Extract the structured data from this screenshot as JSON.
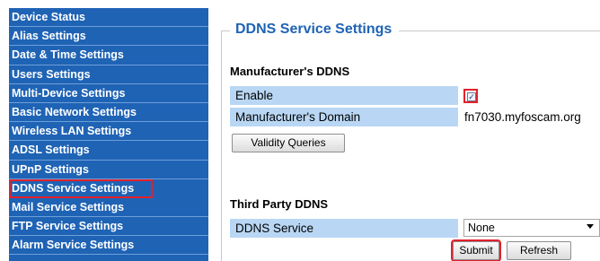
{
  "sidebar": {
    "items": [
      {
        "label": "Device Status"
      },
      {
        "label": "Alias Settings"
      },
      {
        "label": "Date & Time Settings"
      },
      {
        "label": "Users Settings"
      },
      {
        "label": "Multi-Device Settings"
      },
      {
        "label": "Basic Network Settings"
      },
      {
        "label": "Wireless LAN Settings"
      },
      {
        "label": "ADSL Settings"
      },
      {
        "label": "UPnP Settings"
      },
      {
        "label": "DDNS Service Settings"
      },
      {
        "label": "Mail Service Settings"
      },
      {
        "label": "FTP Service Settings"
      },
      {
        "label": "Alarm Service Settings"
      }
    ],
    "active_index": 9
  },
  "main": {
    "title": "DDNS Service Settings",
    "manufacturer": {
      "section_title": "Manufacturer's DDNS",
      "enable_label": "Enable",
      "enable_checked": true,
      "domain_label": "Manufacturer's Domain",
      "domain_value": "fn7030.myfoscam.org",
      "validity_button": "Validity Queries"
    },
    "third_party": {
      "section_title": "Third Party DDNS",
      "service_label": "DDNS Service",
      "service_value": "None"
    },
    "submit_button": "Submit",
    "refresh_button": "Refresh"
  },
  "colors": {
    "sidebar_bg": "#1f63b5",
    "title_blue": "#1f63b5",
    "row_bg": "#b9d7f4",
    "highlight_red": "#e2212b"
  }
}
